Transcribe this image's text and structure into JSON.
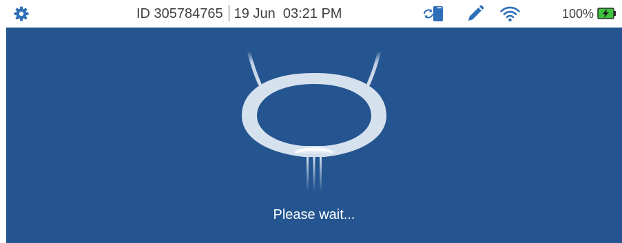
{
  "status_bar": {
    "settings_icon": "gear-icon",
    "device_id": "ID 305784765",
    "datetime": "19 Jun  03:21 PM",
    "sync_icon": "device-sync-icon",
    "edit_icon": "pencil-icon",
    "wifi_icon": "wifi-icon",
    "battery_percent": "100%",
    "battery_icon": "battery-charging-icon"
  },
  "main": {
    "graphic_icon": "bladder-icon",
    "message": "Please wait..."
  },
  "colors": {
    "accent": "#2f6fb9",
    "panel_background": "#245590",
    "battery_fill": "#3ec43e",
    "message_text": "#ffffff"
  }
}
